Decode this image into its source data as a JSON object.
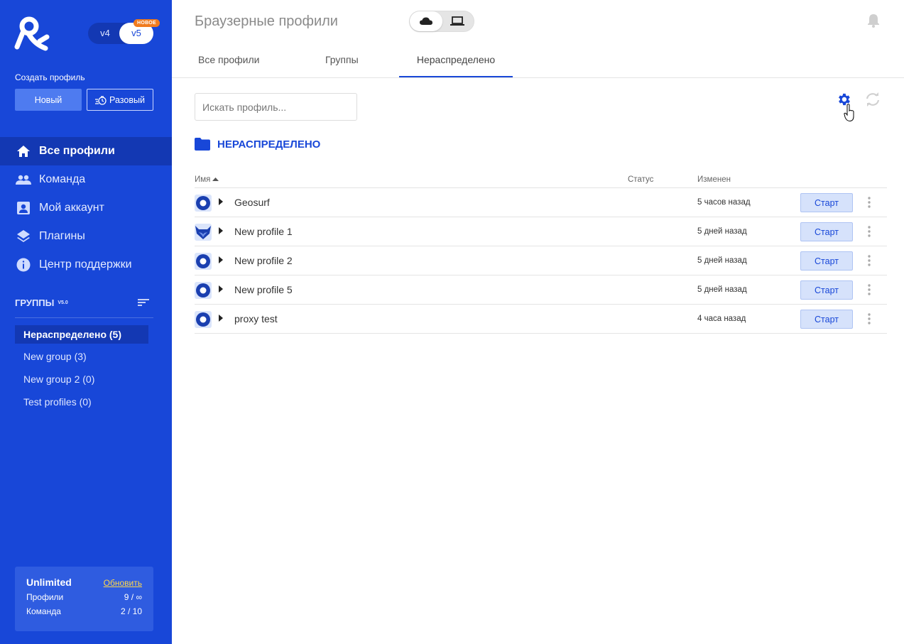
{
  "sidebar": {
    "version": {
      "v4": "v4",
      "v5": "v5",
      "badge": "НОВОЕ"
    },
    "create_label": "Создать профиль",
    "new_button": "Новый",
    "once_button": "Разовый",
    "nav": [
      {
        "label": "Все профили",
        "icon": "home-icon",
        "active": true
      },
      {
        "label": "Команда",
        "icon": "team-icon"
      },
      {
        "label": "Мой аккаунт",
        "icon": "account-icon"
      },
      {
        "label": "Плагины",
        "icon": "layers-icon"
      },
      {
        "label": "Центр поддержки",
        "icon": "info-icon"
      }
    ],
    "groups_title": "ГРУППЫ",
    "groups_version": "V5.0",
    "groups": [
      {
        "label": "Нераспределено  (5)",
        "active": true
      },
      {
        "label": "New group  (3)"
      },
      {
        "label": "New group 2  (0)"
      },
      {
        "label": "Test profiles  (0)"
      }
    ],
    "plan": {
      "name": "Unlimited",
      "update": "Обновить",
      "profiles_label": "Профили",
      "profiles_value": "9 / ∞",
      "team_label": "Команда",
      "team_value": "2 / 10"
    }
  },
  "header": {
    "title": "Браузерные профили",
    "tabs": [
      "Все профили",
      "Группы",
      "Нераспределено"
    ]
  },
  "search": {
    "placeholder": "Искать профиль..."
  },
  "folder": {
    "title": "НЕРАСПРЕДЕЛЕНО"
  },
  "table": {
    "columns": {
      "name": "Имя",
      "status": "Статус",
      "changed": "Изменен"
    },
    "start_label": "Старт",
    "rows": [
      {
        "name": "Geosurf",
        "changed": "5 часов назад",
        "icon": "mimic-icon"
      },
      {
        "name": "New profile 1",
        "changed": "5 дней назад",
        "icon": "fox-icon"
      },
      {
        "name": "New profile 2",
        "changed": "5 дней назад",
        "icon": "mimic-icon"
      },
      {
        "name": "New profile 5",
        "changed": "5 дней назад",
        "icon": "mimic-icon"
      },
      {
        "name": "proxy test",
        "changed": "4 часа назад",
        "icon": "mimic-icon"
      }
    ]
  },
  "colors": {
    "brand": "#1847d8",
    "sidebar_dark": "#1338b3",
    "badge": "#f07b1e",
    "update_link": "#ffd84a"
  }
}
